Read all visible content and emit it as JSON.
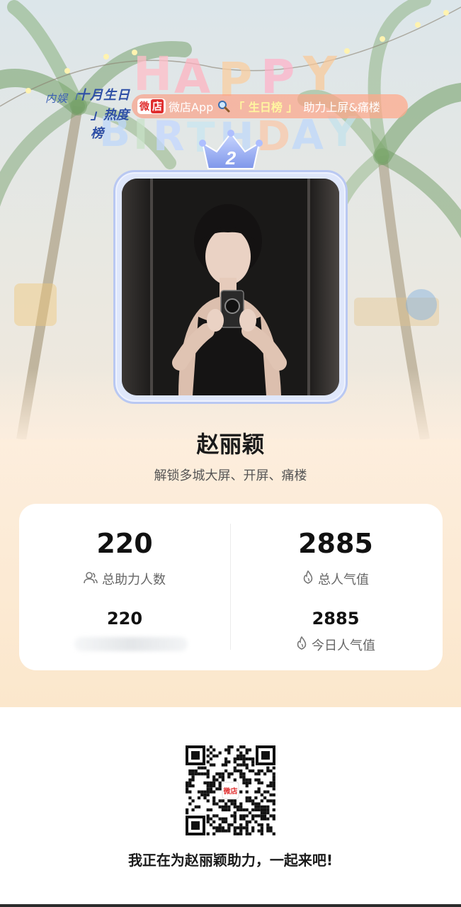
{
  "header": {
    "event_logo_line1": "内娱「",
    "event_logo_line2": "十月生日",
    "event_logo_line3": "」热度榜",
    "happy_word": "HAPPY",
    "birthday_word": "BIRTHDAY",
    "banner": {
      "badge_a": "微",
      "badge_b": "店",
      "text": "微店App",
      "rank_label": "「 生日榜 」",
      "cta": "助力上屏&痛楼"
    },
    "crown_rank": "2"
  },
  "profile": {
    "name": "赵丽颖",
    "subtitle": "解锁多城大屏、开屏、痛楼"
  },
  "stats": {
    "total_supporters": "220",
    "total_supporters_label": "总助力人数",
    "total_popularity": "2885",
    "total_popularity_label": "总人气值",
    "today_supporters": "220",
    "today_popularity": "2885",
    "today_popularity_label": "今日人气值"
  },
  "footer": {
    "invite_text": "我正在为赵丽颖助力，一起来吧!",
    "qr_center_badge": "微店"
  },
  "colors": {
    "accent_blue": "#b9c8f2",
    "banner_orange": "#ff9a80",
    "badge_red": "#e02e2e"
  }
}
